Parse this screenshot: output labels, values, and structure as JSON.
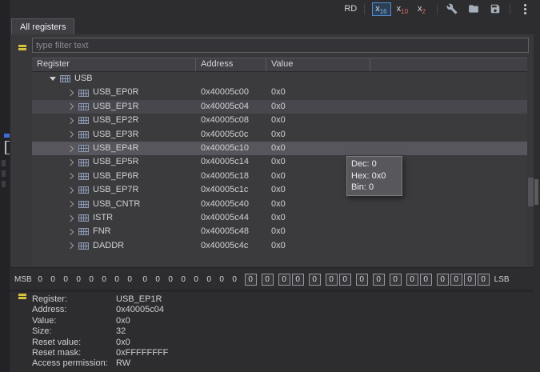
{
  "toolbar": {
    "rd_label": "RD",
    "format_buttons": [
      {
        "base": "x",
        "sub": "16",
        "cls": "active"
      },
      {
        "base": "x",
        "sub": "10",
        "cls": ""
      },
      {
        "base": "x",
        "sub": "2",
        "cls": ""
      }
    ],
    "icons": [
      "wrench-icon",
      "open-icon",
      "save-icon",
      "overflow-menu-icon"
    ]
  },
  "tabs": {
    "all_registers": "All registers"
  },
  "filter": {
    "placeholder": "type filter text"
  },
  "table": {
    "columns": [
      "Register",
      "Address",
      "Value",
      ""
    ],
    "rows": [
      {
        "cls": "group",
        "chev": "down",
        "name": "USB",
        "address": "",
        "value": ""
      },
      {
        "cls": "reg",
        "chev": "right",
        "name": "USB_EP0R",
        "address": "0x40005c00",
        "value": "0x0"
      },
      {
        "cls": "reg selected",
        "chev": "right",
        "name": "USB_EP1R",
        "address": "0x40005c04",
        "value": "0x0"
      },
      {
        "cls": "reg",
        "chev": "right",
        "name": "USB_EP2R",
        "address": "0x40005c08",
        "value": "0x0"
      },
      {
        "cls": "reg",
        "chev": "right",
        "name": "USB_EP3R",
        "address": "0x40005c0c",
        "value": "0x0"
      },
      {
        "cls": "reg hover",
        "chev": "right",
        "name": "USB_EP4R",
        "address": "0x40005c10",
        "value": "0x0"
      },
      {
        "cls": "reg",
        "chev": "right",
        "name": "USB_EP5R",
        "address": "0x40005c14",
        "value": "0x0"
      },
      {
        "cls": "reg",
        "chev": "right",
        "name": "USB_EP6R",
        "address": "0x40005c18",
        "value": "0x0"
      },
      {
        "cls": "reg",
        "chev": "right",
        "name": "USB_EP7R",
        "address": "0x40005c1c",
        "value": "0x0"
      },
      {
        "cls": "reg",
        "chev": "right",
        "name": "USB_CNTR",
        "address": "0x40005c40",
        "value": "0x0"
      },
      {
        "cls": "reg",
        "chev": "right",
        "name": "ISTR",
        "address": "0x40005c44",
        "value": "0x0"
      },
      {
        "cls": "reg",
        "chev": "right",
        "name": "FNR",
        "address": "0x40005c48",
        "value": "0x0"
      },
      {
        "cls": "reg",
        "chev": "right",
        "name": "DADDR",
        "address": "0x40005c4c",
        "value": "0x0"
      }
    ]
  },
  "tooltip": {
    "lines": [
      {
        "text": "Dec: 0"
      },
      {
        "text": "Hex: 0x0"
      },
      {
        "text": "Bin: 0"
      }
    ]
  },
  "bitbar": {
    "msb_label": "MSB",
    "lsb_label": "LSB",
    "bits": [
      {
        "v": "0",
        "cls": "plain"
      },
      {
        "v": "0",
        "cls": "plain"
      },
      {
        "v": "0",
        "cls": "plain"
      },
      {
        "v": "0",
        "cls": "plain"
      },
      {
        "v": "0",
        "cls": "plain"
      },
      {
        "v": "0",
        "cls": "plain"
      },
      {
        "v": "0",
        "cls": "plain"
      },
      {
        "v": "0",
        "cls": "plain gap"
      },
      {
        "v": "0",
        "cls": "plain"
      },
      {
        "v": "0",
        "cls": "plain"
      },
      {
        "v": "0",
        "cls": "plain"
      },
      {
        "v": "0",
        "cls": "plain"
      },
      {
        "v": "0",
        "cls": "plain"
      },
      {
        "v": "0",
        "cls": "plain"
      },
      {
        "v": "0",
        "cls": "plain"
      },
      {
        "v": "0",
        "cls": "plain gap"
      },
      {
        "v": "0",
        "cls": "box gap"
      },
      {
        "v": "0",
        "cls": "box gap"
      },
      {
        "v": "0",
        "cls": "box"
      },
      {
        "v": "0",
        "cls": "box gap"
      },
      {
        "v": "0",
        "cls": "box gap"
      },
      {
        "v": "0",
        "cls": "box"
      },
      {
        "v": "0",
        "cls": "box gap"
      },
      {
        "v": "0",
        "cls": "box gap"
      },
      {
        "v": "0",
        "cls": "box gap"
      },
      {
        "v": "0",
        "cls": "box gap"
      },
      {
        "v": "0",
        "cls": "box"
      },
      {
        "v": "0",
        "cls": "box gap"
      },
      {
        "v": "0",
        "cls": "box"
      },
      {
        "v": "0",
        "cls": "box"
      },
      {
        "v": "0",
        "cls": "box"
      },
      {
        "v": "0",
        "cls": "box"
      }
    ]
  },
  "details": {
    "rows": [
      {
        "label": "Register:",
        "value": "USB_EP1R"
      },
      {
        "label": "Address:",
        "value": "0x40005c04"
      },
      {
        "label": "Value:",
        "value": "0x0"
      },
      {
        "label": "Size:",
        "value": "32"
      },
      {
        "label": "Reset value:",
        "value": "0x0"
      },
      {
        "label": "Reset mask:",
        "value": "0xFFFFFFFF"
      },
      {
        "label": "Access permission:",
        "value": "RW"
      }
    ]
  }
}
